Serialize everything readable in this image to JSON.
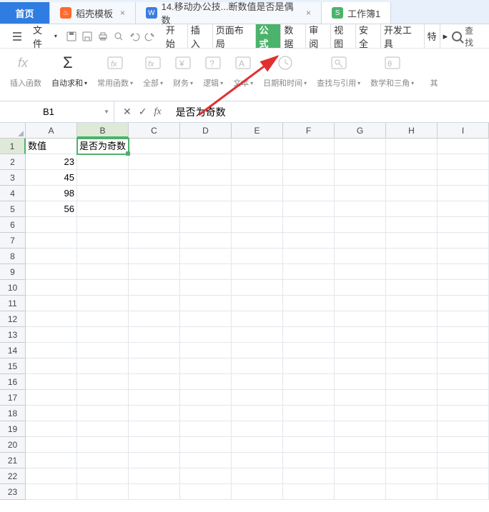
{
  "tabs": {
    "home": "首页",
    "t1": "稻壳模板",
    "t2": "14.移动办公技...断数值是否是偶数",
    "t3": "工作簿1"
  },
  "menu": {
    "file": "文件",
    "search": "查找"
  },
  "ribbontabs": {
    "start": "开始",
    "insert": "插入",
    "layout": "页面布局",
    "formula": "公式",
    "data": "数据",
    "review": "审阅",
    "view": "视图",
    "security": "安全",
    "dev": "开发工具",
    "extra": "特"
  },
  "ribbon": {
    "insertfn": "插入函数",
    "autosum": "自动求和",
    "common": "常用函数",
    "all": "全部",
    "finance": "财务",
    "logic": "逻辑",
    "text": "文本",
    "datetime": "日期和时间",
    "lookup": "查找与引用",
    "math": "数学和三角",
    "other": "其"
  },
  "formulabar": {
    "name": "B1",
    "value": "是否为奇数"
  },
  "cols": [
    "A",
    "B",
    "C",
    "D",
    "E",
    "F",
    "G",
    "H",
    "I"
  ],
  "grid": {
    "a1": "数值",
    "b1": "是否为奇数",
    "a2": "23",
    "a3": "45",
    "a4": "98",
    "a5": "56"
  }
}
